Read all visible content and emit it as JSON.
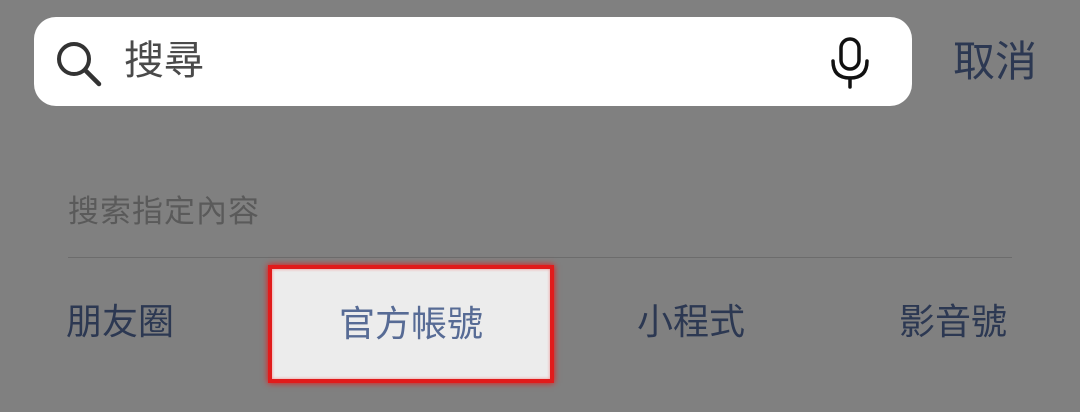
{
  "search": {
    "placeholder": "搜尋"
  },
  "cancel_label": "取消",
  "section_title": "搜索指定內容",
  "categories": [
    {
      "label": "朋友圈"
    },
    {
      "label": "官方帳號"
    },
    {
      "label": "小程式"
    },
    {
      "label": "影音號"
    }
  ],
  "colors": {
    "background": "#808080",
    "link_text": "#2c3852",
    "highlight_border": "#e11b1b",
    "highlight_fill": "#ececec"
  },
  "icons": {
    "search": "search-icon",
    "microphone": "microphone-icon"
  }
}
